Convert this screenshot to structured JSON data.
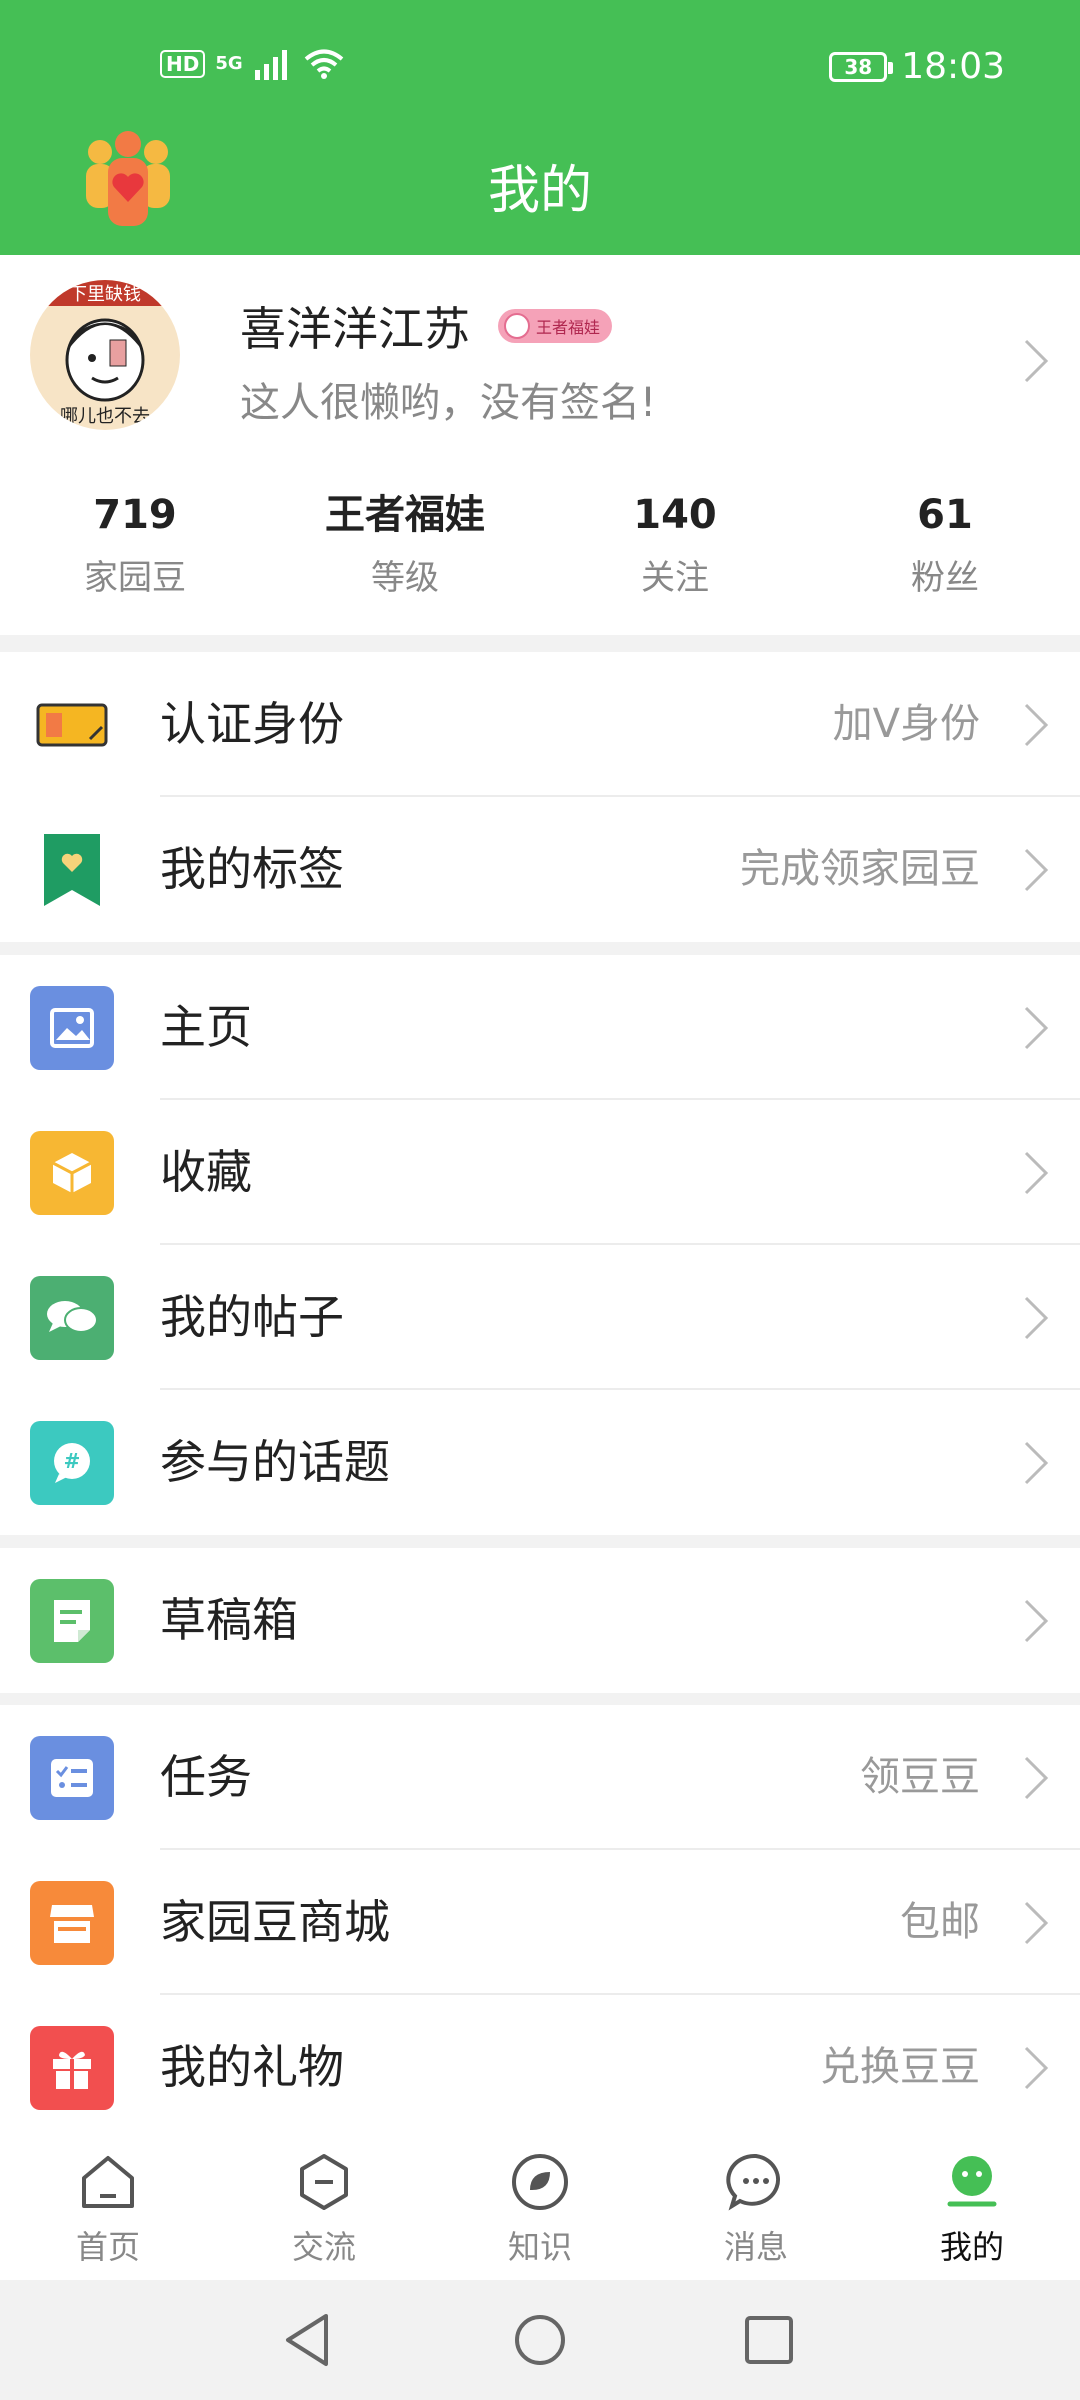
{
  "status_bar": {
    "hd": "HD",
    "network": "5G",
    "battery": "38",
    "time": "18:03"
  },
  "header": {
    "title": "我的"
  },
  "profile": {
    "username": "喜洋洋江苏",
    "badge": "王者福娃",
    "signature": "这人很懒哟，没有签名!",
    "avatar_text_top": "下里缺钱",
    "avatar_text_bottom": "哪儿也不去"
  },
  "stats": [
    {
      "value": "719",
      "label": "家园豆"
    },
    {
      "value": "王者福娃",
      "label": "等级"
    },
    {
      "value": "140",
      "label": "关注"
    },
    {
      "value": "61",
      "label": "粉丝"
    }
  ],
  "menu": {
    "verify": {
      "label": "认证身份",
      "hint": "加V身份"
    },
    "tags": {
      "label": "我的标签",
      "hint": "完成领家园豆"
    },
    "home": {
      "label": "主页"
    },
    "favorites": {
      "label": "收藏"
    },
    "posts": {
      "label": "我的帖子"
    },
    "topics": {
      "label": "参与的话题"
    },
    "drafts": {
      "label": "草稿箱"
    },
    "tasks": {
      "label": "任务",
      "hint": "领豆豆"
    },
    "shop": {
      "label": "家园豆商城",
      "hint": "包邮"
    },
    "gifts": {
      "label": "我的礼物",
      "hint": "兑换豆豆"
    }
  },
  "icon_colors": {
    "home": "#6a8fe0",
    "favorites": "#f7b733",
    "posts": "#4caf72",
    "topics": "#3cc9c0",
    "drafts": "#5cbf6b",
    "tasks": "#6a8fe0",
    "shop": "#f78a3a",
    "gifts": "#f24f4f"
  },
  "bottom_nav": [
    {
      "label": "首页",
      "icon": "home-icon"
    },
    {
      "label": "交流",
      "icon": "chat-hexagon-icon"
    },
    {
      "label": "知识",
      "icon": "leaf-circle-icon"
    },
    {
      "label": "消息",
      "icon": "message-bubble-icon"
    },
    {
      "label": "我的",
      "icon": "profile-face-icon",
      "active": true
    }
  ],
  "theme": {
    "primary": "#45bf55"
  }
}
